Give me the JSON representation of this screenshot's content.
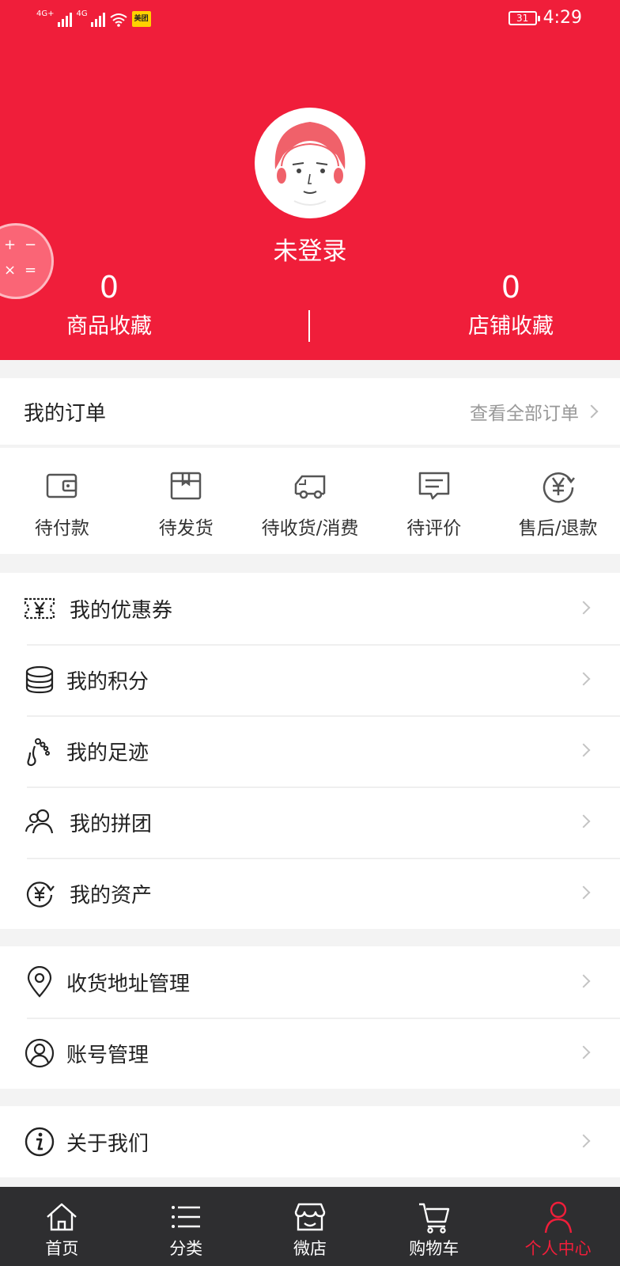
{
  "status_bar": {
    "sig1_label": "4G+",
    "sig2_label": "4G",
    "battery": "31",
    "time": "4:29",
    "meituan_icon": "美团"
  },
  "profile": {
    "username": "未登录",
    "product_fav_count": "0",
    "product_fav_label": "商品收藏",
    "shop_fav_count": "0",
    "shop_fav_label": "店铺收藏"
  },
  "orders": {
    "title": "我的订单",
    "view_all": "查看全部订单",
    "items": [
      {
        "label": "待付款",
        "icon": "wallet-icon"
      },
      {
        "label": "待发货",
        "icon": "box-icon"
      },
      {
        "label": "待收货/消费",
        "icon": "truck-icon"
      },
      {
        "label": "待评价",
        "icon": "comment-icon"
      },
      {
        "label": "售后/退款",
        "icon": "yen-refund-icon"
      }
    ]
  },
  "menu_group1": [
    {
      "label": "我的优惠券",
      "icon": "coupon-icon"
    },
    {
      "label": "我的积分",
      "icon": "coins-icon"
    },
    {
      "label": "我的足迹",
      "icon": "footprint-icon"
    },
    {
      "label": "我的拼团",
      "icon": "group-icon"
    },
    {
      "label": "我的资产",
      "icon": "yen-asset-icon"
    }
  ],
  "menu_group2": [
    {
      "label": "收货地址管理",
      "icon": "location-icon"
    },
    {
      "label": "账号管理",
      "icon": "account-icon"
    }
  ],
  "menu_group3": [
    {
      "label": "关于我们",
      "icon": "info-icon"
    }
  ],
  "tabbar": [
    {
      "label": "首页",
      "icon": "home-icon"
    },
    {
      "label": "分类",
      "icon": "list-icon"
    },
    {
      "label": "微店",
      "icon": "store-icon"
    },
    {
      "label": "购物车",
      "icon": "cart-icon"
    },
    {
      "label": "个人中心",
      "icon": "person-icon",
      "active": true
    }
  ],
  "colors": {
    "brand_red": "#f01e3a",
    "tabbar_bg": "#2e2e30"
  }
}
